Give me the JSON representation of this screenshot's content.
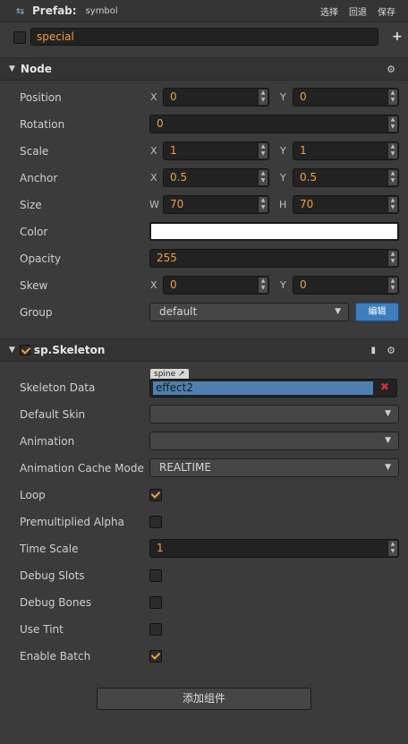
{
  "header": {
    "prefab_label": "Prefab:",
    "prefab_name": "symbol",
    "btn_select": "选择",
    "btn_revert": "回退",
    "btn_save": "保存"
  },
  "node_name": {
    "value": "special",
    "active": false
  },
  "node_section": {
    "title": "Node",
    "position": {
      "label": "Position",
      "x_axis": "X",
      "x": "0",
      "y_axis": "Y",
      "y": "0"
    },
    "rotation": {
      "label": "Rotation",
      "value": "0"
    },
    "scale": {
      "label": "Scale",
      "x_axis": "X",
      "x": "1",
      "y_axis": "Y",
      "y": "1"
    },
    "anchor": {
      "label": "Anchor",
      "x_axis": "X",
      "x": "0.5",
      "y_axis": "Y",
      "y": "0.5"
    },
    "size": {
      "label": "Size",
      "w_axis": "W",
      "w": "70",
      "h_axis": "H",
      "h": "70"
    },
    "color": {
      "label": "Color",
      "value": "#ffffff"
    },
    "opacity": {
      "label": "Opacity",
      "value": "255"
    },
    "skew": {
      "label": "Skew",
      "x_axis": "X",
      "x": "0",
      "y_axis": "Y",
      "y": "0"
    },
    "group": {
      "label": "Group",
      "value": "default",
      "edit_label": "编辑"
    }
  },
  "skeleton_section": {
    "title": "sp.Skeleton",
    "enabled": true,
    "skeleton_data": {
      "label": "Skeleton Data",
      "tag": "spine",
      "value": "effect2"
    },
    "default_skin": {
      "label": "Default Skin",
      "value": ""
    },
    "animation": {
      "label": "Animation",
      "value": ""
    },
    "cache_mode": {
      "label": "Animation Cache Mode",
      "value": "REALTIME"
    },
    "loop": {
      "label": "Loop",
      "checked": true
    },
    "premultiplied_alpha": {
      "label": "Premultiplied Alpha",
      "checked": false
    },
    "time_scale": {
      "label": "Time Scale",
      "value": "1"
    },
    "debug_slots": {
      "label": "Debug Slots",
      "checked": false
    },
    "debug_bones": {
      "label": "Debug Bones",
      "checked": false
    },
    "use_tint": {
      "label": "Use Tint",
      "checked": false
    },
    "enable_batch": {
      "label": "Enable Batch",
      "checked": true
    }
  },
  "add_component_label": "添加组件",
  "colors": {
    "accent": "#f0a040",
    "background": "#3b3b3b",
    "edit_button": "#3c7ec0",
    "asset_highlight": "#4d7fb2"
  }
}
